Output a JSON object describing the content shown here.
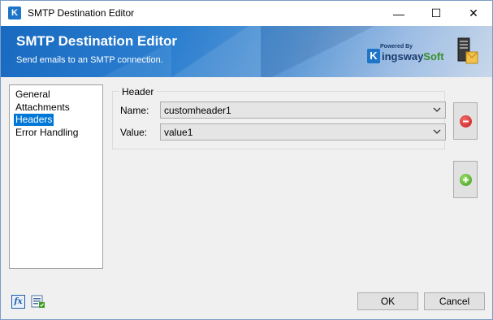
{
  "window": {
    "title": "SMTP Destination Editor",
    "minimize_glyph": "—",
    "maximize_glyph": "☐",
    "close_glyph": "✕"
  },
  "banner": {
    "title": "SMTP Destination Editor",
    "subtitle": "Send emails to an SMTP connection.",
    "logo_powered": "Powered By",
    "logo_k": "K",
    "logo_name_main": "ingsway",
    "logo_name_soft": "Soft"
  },
  "sidebar": {
    "items": [
      {
        "label": "General"
      },
      {
        "label": "Attachments"
      },
      {
        "label": "Headers",
        "selected": true
      },
      {
        "label": "Error Handling"
      }
    ]
  },
  "header_group": {
    "label": "Header",
    "name_label": "Name:",
    "name_value": "customheader1",
    "value_label": "Value:",
    "value_value": "value1"
  },
  "footer": {
    "fx_label": "fx",
    "ok_label": "OK",
    "cancel_label": "Cancel"
  },
  "colors": {
    "accent": "#0078d7",
    "banner": "#1869c0",
    "remove": "#c81a1a",
    "add": "#3c9a1c"
  },
  "icons": [
    "app-icon",
    "minimize-icon",
    "maximize-icon",
    "close-icon",
    "server-icon",
    "remove-icon",
    "add-icon",
    "expression-icon",
    "variables-icon",
    "chevron-down-icon"
  ]
}
